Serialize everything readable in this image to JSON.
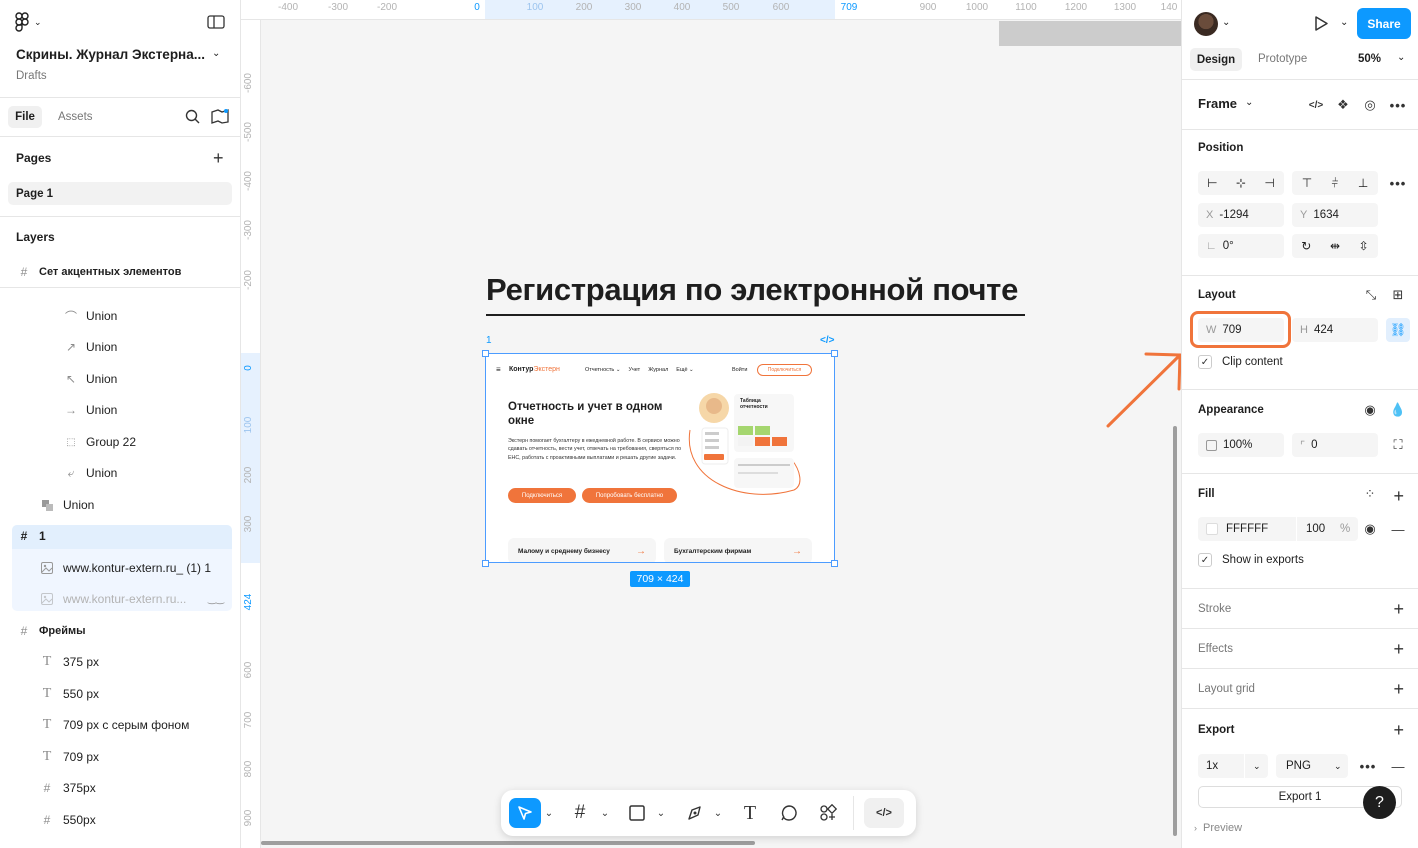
{
  "file": {
    "title": "Скрины. Журнал Экстерна...",
    "location": "Drafts"
  },
  "left_tabs": {
    "file": "File",
    "assets": "Assets"
  },
  "pages": {
    "heading": "Pages",
    "items": [
      "Page 1"
    ]
  },
  "layers": {
    "heading": "Layers",
    "items": [
      {
        "label": "Сет акцентных элементов",
        "icon": "frame-icon",
        "bold": true
      },
      {
        "label": "Union",
        "icon": "arc-icon"
      },
      {
        "label": "Union",
        "icon": "arrow-up-right-icon"
      },
      {
        "label": "Union",
        "icon": "arrow-up-left-icon"
      },
      {
        "label": "Union",
        "icon": "arrow-right-icon"
      },
      {
        "label": "Group 22",
        "icon": "group-icon"
      },
      {
        "label": "Union",
        "icon": "curve-icon"
      },
      {
        "label": "Union",
        "icon": "union-icon"
      },
      {
        "label": "1",
        "icon": "frame-icon",
        "bold": true
      },
      {
        "label": "www.kontur-extern.ru_ (1) 1",
        "icon": "image-icon"
      },
      {
        "label": "www.kontur-extern.ru...",
        "icon": "image-icon",
        "hidden": true
      },
      {
        "label": "Фреймы",
        "icon": "frame-icon",
        "bold": true
      },
      {
        "label": "375 px",
        "icon": "text-icon"
      },
      {
        "label": "550 px",
        "icon": "text-icon"
      },
      {
        "label": "709 px с серым фоном",
        "icon": "text-icon"
      },
      {
        "label": "709 px",
        "icon": "text-icon"
      },
      {
        "label": "375px",
        "icon": "frame-icon"
      },
      {
        "label": "550px",
        "icon": "frame-icon"
      }
    ]
  },
  "rulers": {
    "top": [
      "-400",
      "-300",
      "-200",
      "0",
      "100",
      "200",
      "300",
      "400",
      "500",
      "600",
      "709",
      "900",
      "1000",
      "1100",
      "1200",
      "1300",
      "140"
    ],
    "left": [
      "-600",
      "-500",
      "-400",
      "-300",
      "-200",
      "0",
      "100",
      "200",
      "300",
      "424",
      "600",
      "700",
      "800",
      "900"
    ]
  },
  "canvas": {
    "heading": "Регистрация по электронной почте",
    "frame_label": "1",
    "size_badge": "709 × 424",
    "frame_content": {
      "logo_a": "Контур",
      "logo_b": "Экстерн",
      "nav": [
        "Отчетность ⌄",
        "Учет",
        "Журнал",
        "Ещё ⌄"
      ],
      "login": "Войти",
      "connect": "Подключиться",
      "hero_title": "Отчетность и учет в одном окне",
      "hero_text": "Экстерн помогает бухгалтеру в ежедневной работе. В сервисе можно сдавать отчетность, вести учет, отвечать на требования, сверяться по ЕНС, работать с проактивными выплатами и решать другие задачи.",
      "cta_primary": "Подключиться",
      "cta_secondary": "Попробовать бесплатно",
      "table_title": "Таблица отчетности",
      "card1": "Малому и среднему бизнесу",
      "card2": "Бухгалтерским фирмам"
    }
  },
  "right": {
    "tabs": {
      "design": "Design",
      "prototype": "Prototype"
    },
    "zoom": "50%",
    "share": "Share",
    "frame_type": "Frame",
    "position": {
      "heading": "Position",
      "x_label": "X",
      "x": "-1294",
      "y_label": "Y",
      "y": "1634",
      "rotation": "0°"
    },
    "layout": {
      "heading": "Layout",
      "w_label": "W",
      "w": "709",
      "h_label": "H",
      "h": "424",
      "clip": "Clip content"
    },
    "appearance": {
      "heading": "Appearance",
      "opacity": "100%",
      "radius": "0"
    },
    "fill": {
      "heading": "Fill",
      "hex": "FFFFFF",
      "opacity": "100",
      "percent": "%",
      "show_exports": "Show in exports"
    },
    "stroke": "Stroke",
    "effects": "Effects",
    "layout_grid": "Layout grid",
    "export": {
      "heading": "Export",
      "scale": "1x",
      "format": "PNG",
      "button": "Export 1"
    },
    "preview": "Preview",
    "help": "?"
  },
  "colors": {
    "accent": "#0d99ff",
    "orange": "#f0743b",
    "selection": "#4c9cff"
  }
}
